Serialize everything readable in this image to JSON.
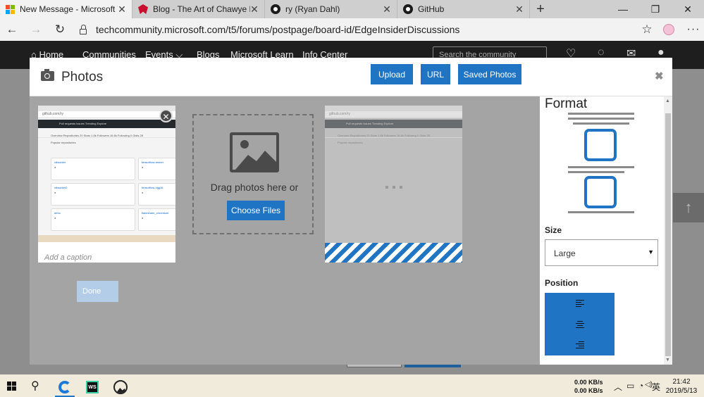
{
  "browser": {
    "tabs": [
      {
        "title": "New Message - Microsoft Tech C",
        "icon": "microsoft-icon",
        "active": true
      },
      {
        "title": "Blog - The Art of Chawye Hsu",
        "icon": "red-bird-icon",
        "active": false
      },
      {
        "title": "ry (Ryan Dahl)",
        "icon": "github-icon",
        "active": false
      },
      {
        "title": "GitHub",
        "icon": "github-icon",
        "active": false
      }
    ],
    "close_glyph": "✕",
    "new_tab_glyph": "+",
    "window_controls": {
      "minimize": "—",
      "restore": "❐",
      "close": "✕"
    },
    "url": "techcommunity.microsoft.com/t5/forums/postpage/board-id/EdgeInsiderDiscussions",
    "nav": {
      "back": "←",
      "forward": "→",
      "refresh": "↻",
      "favorite": "☆",
      "more": "···"
    }
  },
  "site": {
    "nav_items": [
      "⌂ Home",
      "Communities",
      "Events ⌵",
      "Blogs",
      "Microsoft Learn",
      "Info Center"
    ],
    "search_placeholder": "Search the community",
    "icons": {
      "heart": "♡",
      "bell": "◌",
      "mail": "✉",
      "user": "●"
    },
    "scroll_top": "↑"
  },
  "modal": {
    "title": "Photos",
    "buttons": {
      "upload": "Upload",
      "url": "URL",
      "saved": "Saved Photos"
    },
    "close": "✖",
    "thumb_close": "✕",
    "caption_placeholder": "Add a caption",
    "dropzone": {
      "text": "Drag photos here or",
      "button": "Choose Files"
    },
    "mini": {
      "address": "github.com/ry",
      "nav": "Pull requests   Issues   Trending   Explore",
      "tabs": "Overview   Repositories 20   Stars 1.8k   Followers 16.6k   Following 0   Gists 28",
      "popular": "Popular repositories",
      "cards": [
        "v8worker",
        "tensorflow-resnet",
        "v8worker2",
        "tensorflow-vgg16",
        "deno",
        "flakeshare_chromium"
      ]
    }
  },
  "format_panel": {
    "title": "Format",
    "size_label": "Size",
    "size_value": "Large",
    "size_caret": "▼",
    "position_label": "Position",
    "done": "Done",
    "scroll_up": "▲",
    "scroll_down": "▼"
  },
  "taskbar": {
    "search_glyph": "⚲",
    "ws_label": "WS",
    "net_up": "0.00 KB/s",
    "net_down": "0.00 KB/s",
    "tray": {
      "chevron": "︿",
      "battery": "▭",
      "wifi": "◔",
      "volume": "◁)",
      "ime": "英"
    },
    "time": "21:42",
    "date": "2019/5/13"
  },
  "colors": {
    "accent": "#1f74c4",
    "overlay": "#a4a4a4",
    "taskbar": "#f1ebdc",
    "site_nav": "#1e1e1e"
  }
}
